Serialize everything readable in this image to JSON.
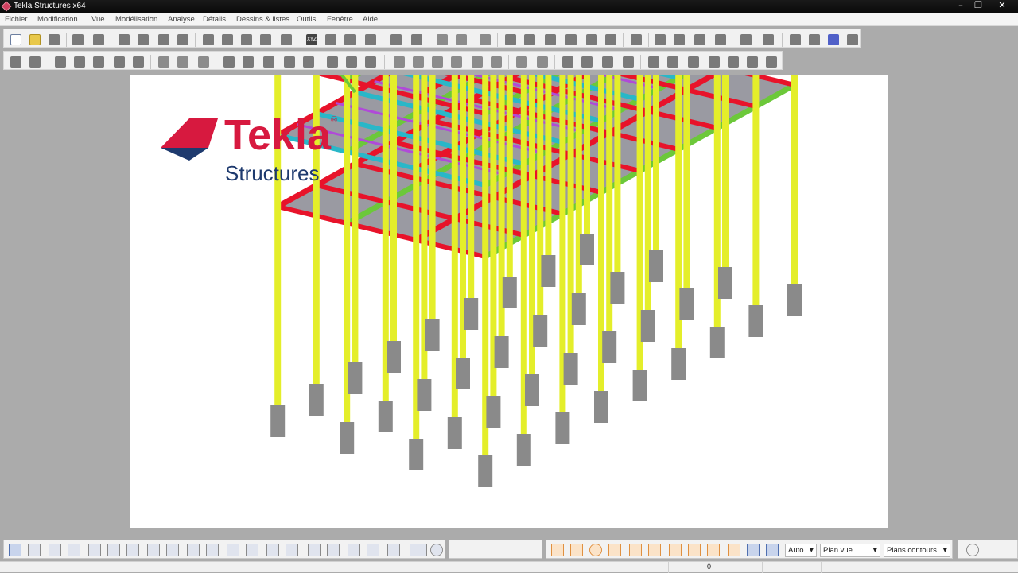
{
  "window": {
    "title": "Tekla Structures x64",
    "minimize_glyph": "–",
    "restore_glyph": "❐",
    "close_glyph": "✕"
  },
  "menu": {
    "items": [
      "Fichier",
      "Modification",
      "Vue",
      "Modélisation",
      "Analyse",
      "Détails",
      "Dessins & listes",
      "Outils",
      "Fenêtre",
      "Aide"
    ]
  },
  "toolbar": {
    "xyz_label": "XYZ"
  },
  "viewport": {
    "logo_text": "Tekla",
    "logo_registered": "®",
    "logo_subtitle": "Structures",
    "logo_red": "#d7193f",
    "logo_blue": "#1e3a6e"
  },
  "bottom_toolbar": {
    "snap_mode": "Auto",
    "view_plane": "Plan vue",
    "contour_planes": "Plans contours"
  },
  "status": {
    "value": "0"
  },
  "colors": {
    "beam_red": "#e8132a",
    "column_yellow": "#e4ee2a",
    "brace_green": "#6cc83a",
    "grating_grey": "#9a9aa2",
    "purlin_purple": "#b04ad8",
    "cyan_member": "#29b7c8",
    "concrete_grey": "#8a8a8a"
  }
}
